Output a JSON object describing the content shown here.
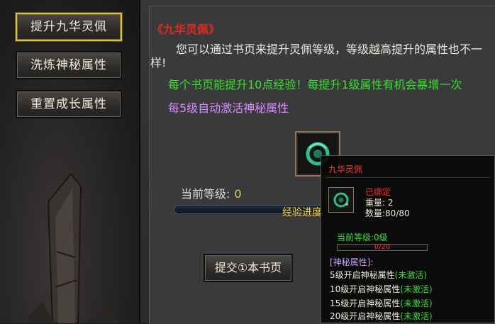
{
  "sidebar": {
    "buttons": [
      "提升九华灵佩",
      "洗炼神秘属性",
      "重置成长属性"
    ]
  },
  "main": {
    "title": "《九华灵佩》",
    "description": "您可以通过书页来提升灵佩等级，等级越高提升的属性也不一样!",
    "green_line": "每个书页能提升10点经验！每提升1级属性有机会暴增一次",
    "purple_line": "每5级自动激活神秘属性",
    "level_label": "当前等级:",
    "level_value": "0",
    "exp_label": "经验进度",
    "submit_button": "提交①本书页"
  },
  "tooltip": {
    "name": "九华灵佩",
    "bound": "已绑定",
    "weight": "重量: 2",
    "quantity": "数量:80/80",
    "current_level": "当前等级:0级",
    "progress_text": "0/20",
    "progress": 0,
    "section_title": "[神秘属性]:",
    "attributes": [
      {
        "text": "5级开启神秘属性",
        "status": "(未激活)"
      },
      {
        "text": "10级开启神秘属性",
        "status": "(未激活)"
      },
      {
        "text": "15级开启神秘属性",
        "status": "(未激活)"
      },
      {
        "text": "20级开启神秘属性",
        "status": "(未激活)"
      }
    ]
  },
  "colors": {
    "title_red": "#e02a1a",
    "green_text": "#39e02c",
    "purple_text": "#d98cff",
    "gold_text": "#e8c55a",
    "active_border": "#d8c24a"
  },
  "icons": {
    "item": "jade-pendant-icon"
  }
}
